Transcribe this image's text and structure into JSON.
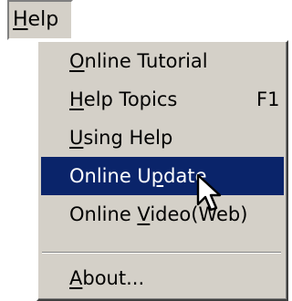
{
  "menubar": {
    "title": {
      "mnemonic": "H",
      "rest": "elp"
    }
  },
  "menu": {
    "items": [
      {
        "mnemonic": "O",
        "rest": "nline Tutorial",
        "shortcut": ""
      },
      {
        "mnemonic": "H",
        "rest": "elp Topics",
        "shortcut": "F1"
      },
      {
        "mnemonic": "U",
        "rest": "sing Help",
        "shortcut": ""
      },
      {
        "pre": "Online U",
        "mnemonic": "p",
        "rest": "date",
        "shortcut": ""
      },
      {
        "pre": "Online ",
        "mnemonic": "V",
        "rest": "ideo(Web)",
        "shortcut": ""
      },
      {
        "mnemonic": "A",
        "rest": "bout...",
        "shortcut": ""
      }
    ],
    "highlighted_index": 3
  },
  "colors": {
    "menu_background": "#d4d0c8",
    "highlight_background": "#0a246a",
    "highlight_text": "#ffffff",
    "text": "#000000"
  },
  "cursor": {
    "icon": "arrow-pointer-icon"
  }
}
